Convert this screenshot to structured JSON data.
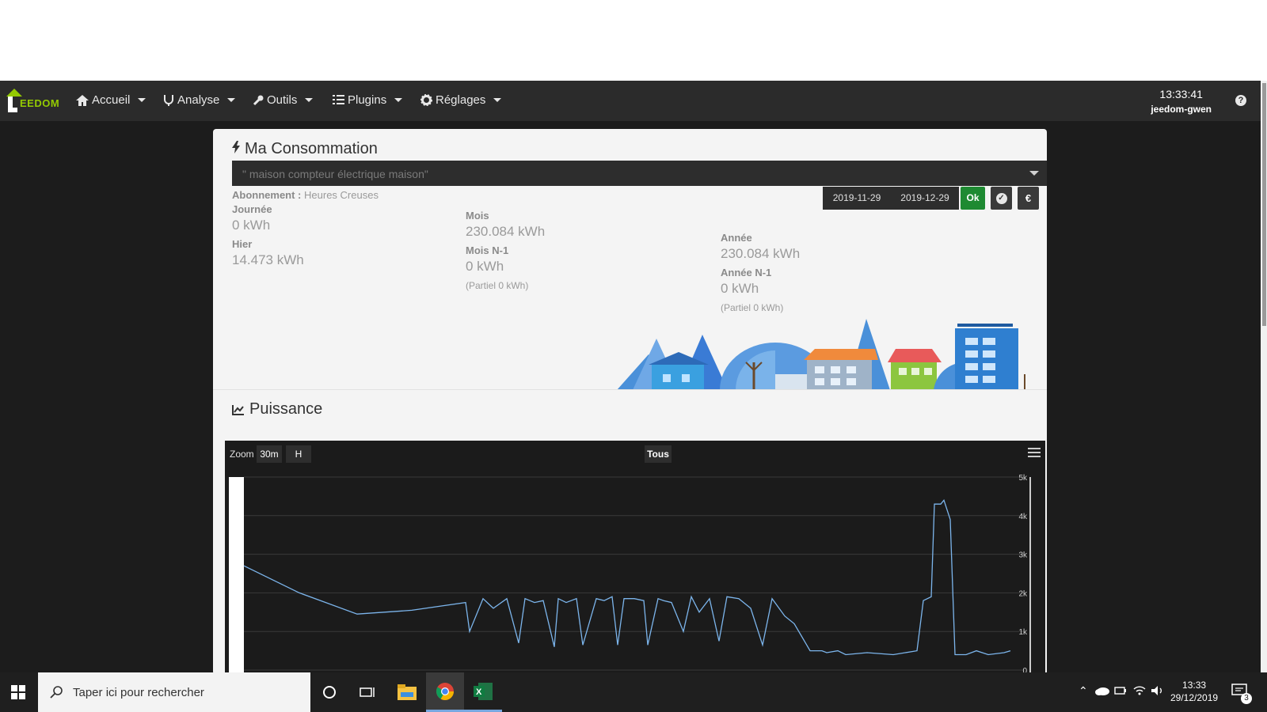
{
  "navbar": {
    "logo_text": "EEDOM",
    "items": [
      {
        "label": "Accueil",
        "icon": "home-icon"
      },
      {
        "label": "Analyse",
        "icon": "analyse-icon"
      },
      {
        "label": "Outils",
        "icon": "wrench-icon"
      },
      {
        "label": "Plugins",
        "icon": "list-icon"
      },
      {
        "label": "Réglages",
        "icon": "gear-icon"
      }
    ],
    "time": "13:33:41",
    "host": "jeedom-gwen",
    "help": "?"
  },
  "consommation": {
    "title": "Ma Consommation",
    "select_value": "\" maison compteur électrique maison\"",
    "abonnement_label": "Abonnement :",
    "abonnement_value": "Heures Creuses",
    "date_start": "2019-11-29",
    "date_end": "2019-12-29",
    "ok_label": "Ok",
    "euro_label": "€",
    "journee_label": "Journée",
    "journee_value": "0 kWh",
    "hier_label": "Hier",
    "hier_value": "14.473 kWh",
    "mois_label": "Mois",
    "mois_value": "230.084 kWh",
    "mois_n1_label": "Mois N-1",
    "mois_n1_value": "0 kWh",
    "mois_partiel": "(Partiel 0 kWh)",
    "annee_label": "Année",
    "annee_value": "230.084 kWh",
    "annee_n1_label": "Année N-1",
    "annee_n1_value": "0 kWh",
    "annee_partiel": "(Partiel 0 kWh)"
  },
  "puissance": {
    "title": "Puissance",
    "zoom_label": "Zoom",
    "zoom_buttons": [
      "30m",
      "H",
      "Tous"
    ]
  },
  "chart_data": {
    "type": "line",
    "title": "",
    "ylim": [
      0,
      5000
    ],
    "y_ticks": [
      "0",
      "1k",
      "2k",
      "3k",
      "4k",
      "5k"
    ],
    "series": [
      {
        "color": "#7cb5ec",
        "x": [
          0,
          70,
          143,
          212,
          280,
          285,
          302,
          315,
          332,
          347,
          355,
          367,
          378,
          392,
          397,
          407,
          420,
          428,
          445,
          455,
          465,
          472,
          480,
          493,
          505,
          510,
          523,
          530,
          540,
          555,
          565,
          575,
          588,
          600,
          610,
          625,
          640,
          655,
          667,
          683,
          695,
          715,
          730,
          736,
          750,
          760,
          787,
          820,
          850,
          858,
          868,
          872,
          880,
          884,
          892,
          898,
          912,
          925,
          940,
          960,
          968
        ],
        "values": [
          2700,
          2000,
          1450,
          1550,
          1750,
          1000,
          1850,
          1600,
          1850,
          700,
          1850,
          1750,
          1800,
          600,
          1850,
          1750,
          1850,
          650,
          1850,
          1800,
          1900,
          650,
          1850,
          1850,
          1800,
          650,
          1850,
          1800,
          1750,
          1000,
          1900,
          1500,
          1850,
          750,
          1900,
          1850,
          1600,
          650,
          1850,
          1400,
          1200,
          500,
          500,
          450,
          500,
          400,
          450,
          400,
          500,
          1800,
          1900,
          4300,
          4300,
          4400,
          3900,
          400,
          400,
          500,
          400,
          450,
          500
        ]
      }
    ]
  }
}
